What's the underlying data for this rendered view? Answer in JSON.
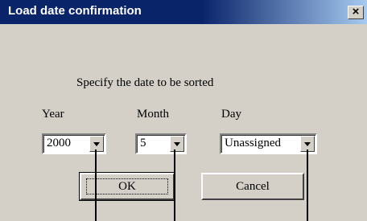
{
  "window": {
    "title": "Load date confirmation",
    "close_glyph": "×"
  },
  "instruction": "Specify the date to be sorted",
  "fields": {
    "year": {
      "label": "Year",
      "value": "2000"
    },
    "month": {
      "label": "Month",
      "value": "5"
    },
    "day": {
      "label": "Day",
      "value": "Unassigned"
    }
  },
  "buttons": {
    "ok": "OK",
    "cancel": "Cancel"
  },
  "icons": {
    "close": "close-icon",
    "dropdown": "dropdown-arrow-icon"
  }
}
